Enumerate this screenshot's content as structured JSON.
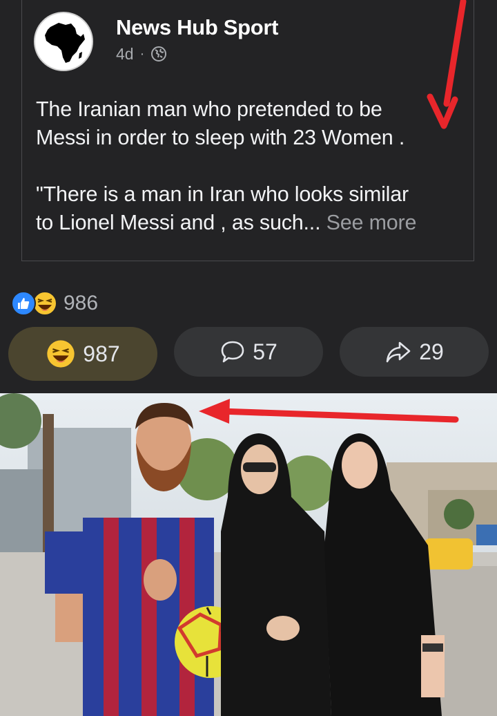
{
  "post": {
    "page_name": "News Hub Sport",
    "time_ago": "4d",
    "separator": "·",
    "privacy_icon": "globe-icon",
    "text_line_1": "The Iranian man who pretended to be",
    "text_line_2": "Messi in order to sleep with 23 Women .",
    "text_line_3": "\"There is a man in Iran who looks similar",
    "text_line_4": "to Lionel Messi and , as such...",
    "see_more": "See more"
  },
  "reactions": {
    "summary_count": "986",
    "icons": [
      "like-icon",
      "haha-icon"
    ]
  },
  "actions": {
    "react_count": "987",
    "comment_count": "57",
    "share_count": "29"
  },
  "colors": {
    "background": "#232325",
    "button": "#343537",
    "react_button_active": "#4b452f",
    "like_blue": "#2d88ff",
    "annotation_red": "#e8262b"
  }
}
